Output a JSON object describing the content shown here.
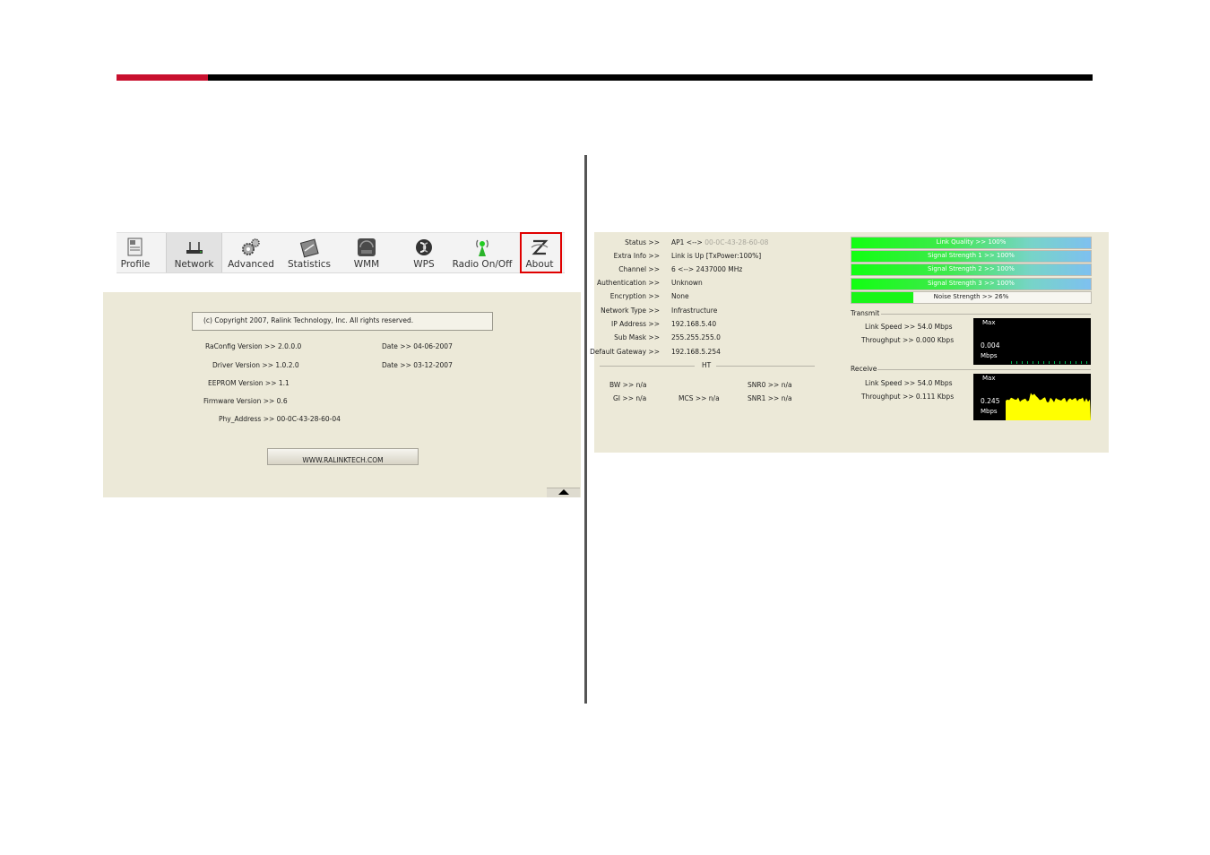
{
  "toolbar": {
    "items": [
      {
        "label": "Profile",
        "icon": "profile-icon"
      },
      {
        "label": "Network",
        "icon": "network-icon"
      },
      {
        "label": "Advanced",
        "icon": "gears-icon"
      },
      {
        "label": "Statistics",
        "icon": "statistics-icon"
      },
      {
        "label": "WMM",
        "icon": "wmm-icon"
      },
      {
        "label": "WPS",
        "icon": "wps-icon"
      },
      {
        "label": "Radio On/Off",
        "icon": "radio-antenna-icon"
      },
      {
        "label": "About",
        "icon": "about-icon"
      }
    ],
    "active": "Network",
    "highlight": "About",
    "highlight_color": "#e00000"
  },
  "about": {
    "copyright": "(c) Copyright 2007, Ralink Technology, Inc.  All rights reserved.",
    "raconfig": "RaConfig Version >> 2.0.0.0",
    "raconfig_date": "Date >> 04-06-2007",
    "driver": "Driver Version >> 1.0.2.0",
    "driver_date": "Date >> 03-12-2007",
    "eeprom": "EEPROM Version >> 1.1",
    "firmware": "Firmware Version >> 0.6",
    "phy": "Phy_Address >> 00-0C-43-28-60-04",
    "website": "WWW.RALINKTECH.COM"
  },
  "status": {
    "labels": [
      "Status >>",
      "Extra Info >>",
      "Channel >>",
      "Authentication >>",
      "Encryption >>",
      "Network Type >>",
      "IP Address >>",
      "Sub Mask >>",
      "Default Gateway >>"
    ],
    "values": [
      "AP1 <-->",
      "Link is Up [TxPower:100%]",
      "6 <--> 2437000 MHz",
      "Unknown",
      "None",
      "Infrastructure",
      "192.168.5.40",
      "255.255.255.0",
      "192.168.5.254"
    ],
    "bssid": "00-0C-43-28-60-08",
    "ht_title": "HT",
    "bw": "BW >> n/a",
    "gi": "GI >> n/a",
    "mcs": "MCS >> n/a",
    "snr0": "SNR0 >> n/a",
    "snr1": "SNR1 >> n/a"
  },
  "signal": [
    {
      "label": "Link Quality >> 100%",
      "value": 100
    },
    {
      "label": "Signal Strength 1 >> 100%",
      "value": 100
    },
    {
      "label": "Signal Strength 2 >> 100%",
      "value": 100
    },
    {
      "label": "Signal Strength 3 >> 100%",
      "value": 100
    },
    {
      "label": "Noise Strength >> 26%",
      "value": 26
    }
  ],
  "transmit": {
    "title": "Transmit",
    "link_speed": "Link Speed >> 54.0 Mbps",
    "throughput": "Throughput >> 0.000 Kbps",
    "graph_max": "Max",
    "graph_value": "0.004",
    "graph_unit": "Mbps",
    "graph_color": "#00b050"
  },
  "receive": {
    "title": "Receive",
    "link_speed": "Link Speed >> 54.0 Mbps",
    "throughput": "Throughput >> 0.111 Kbps",
    "graph_max": "Max",
    "graph_value": "0.245",
    "graph_unit": "Mbps",
    "graph_color": "#ffff00"
  }
}
